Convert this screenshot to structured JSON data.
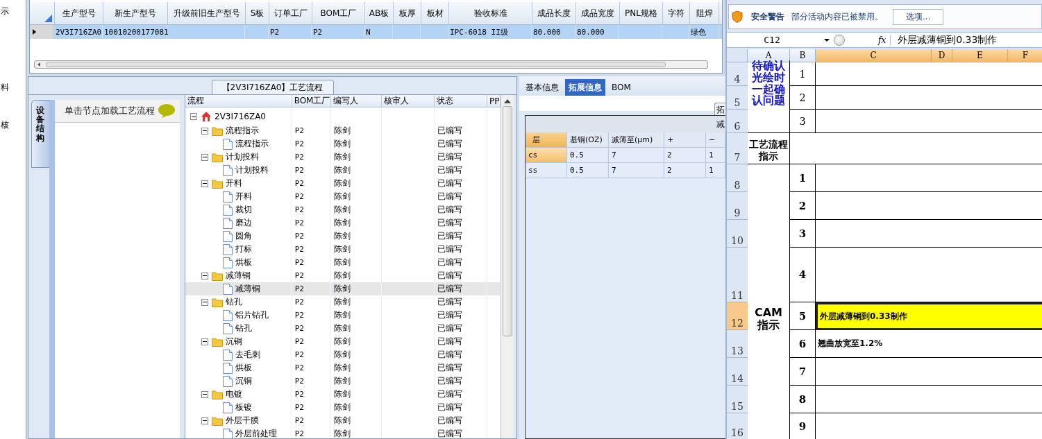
{
  "left_edge": [
    "示",
    "料",
    "核"
  ],
  "product_grid": {
    "columns": [
      "生产型号",
      "新生产型号",
      "升级前旧生产型号",
      "S板",
      "订单工厂",
      "BOM工厂",
      "AB板",
      "板厚",
      "板材",
      "验收标准",
      "成品长度",
      "成品宽度",
      "PNL规格",
      "字符",
      "阻焊"
    ],
    "rows": [
      {
        "selected": true,
        "cells": [
          "2V3I716ZA0",
          "10010200177081",
          "",
          "",
          "P2",
          "P2",
          "N",
          "",
          "",
          "IPC-6018 II级",
          "80.000",
          "80.000",
          "",
          "",
          "绿色"
        ]
      }
    ]
  },
  "process": {
    "title": "【2V3I716ZA0】工艺流程",
    "side_tab": "设备结构",
    "hint": "单击节点加载工艺流程",
    "columns": [
      "流程",
      "BOM工厂",
      "编写人",
      "核审人",
      "状态",
      "PP"
    ],
    "tree": [
      {
        "label": "2V3I716ZA0",
        "kind": "root",
        "selected": false,
        "expanded": true,
        "children": [
          {
            "label": "流程指示",
            "kind": "folder",
            "bom": "P2",
            "author": "陈剑",
            "status": "已编写",
            "selected": false,
            "expanded": true,
            "children": [
              {
                "label": "流程指示",
                "kind": "file",
                "bom": "P2",
                "author": "陈剑",
                "status": "已编写",
                "selected": false
              }
            ]
          },
          {
            "label": "计划投料",
            "kind": "folder",
            "bom": "P2",
            "author": "陈剑",
            "status": "已编写",
            "selected": false,
            "expanded": true,
            "children": [
              {
                "label": "计划投料",
                "kind": "file",
                "bom": "P2",
                "author": "陈剑",
                "status": "已编写",
                "selected": false
              }
            ]
          },
          {
            "label": "开料",
            "kind": "folder",
            "bom": "P2",
            "author": "陈剑",
            "status": "已编写",
            "selected": false,
            "expanded": true,
            "children": [
              {
                "label": "开料",
                "kind": "file",
                "bom": "P2",
                "author": "陈剑",
                "status": "已编写",
                "selected": false
              },
              {
                "label": "裁切",
                "kind": "file",
                "bom": "P2",
                "author": "陈剑",
                "status": "已编写",
                "selected": false
              },
              {
                "label": "磨边",
                "kind": "file",
                "bom": "P2",
                "author": "陈剑",
                "status": "已编写",
                "selected": false
              },
              {
                "label": "圆角",
                "kind": "file",
                "bom": "P2",
                "author": "陈剑",
                "status": "已编写",
                "selected": false
              },
              {
                "label": "打标",
                "kind": "file",
                "bom": "P2",
                "author": "陈剑",
                "status": "已编写",
                "selected": false
              },
              {
                "label": "烘板",
                "kind": "file",
                "bom": "P2",
                "author": "陈剑",
                "status": "已编写",
                "selected": false
              }
            ]
          },
          {
            "label": "减薄铜",
            "kind": "folder",
            "bom": "P2",
            "author": "陈剑",
            "status": "已编写",
            "selected": false,
            "expanded": true,
            "children": [
              {
                "label": "减薄铜",
                "kind": "file",
                "bom": "P2",
                "author": "陈剑",
                "status": "已编写",
                "selected": true
              }
            ]
          },
          {
            "label": "钻孔",
            "kind": "folder",
            "bom": "P2",
            "author": "陈剑",
            "status": "已编写",
            "selected": false,
            "expanded": true,
            "children": [
              {
                "label": "铝片钻孔",
                "kind": "file",
                "bom": "P2",
                "author": "陈剑",
                "status": "已编写",
                "selected": false
              },
              {
                "label": "钻孔",
                "kind": "file",
                "bom": "P2",
                "author": "陈剑",
                "status": "已编写",
                "selected": false
              }
            ]
          },
          {
            "label": "沉铜",
            "kind": "folder",
            "bom": "P2",
            "author": "陈剑",
            "status": "已编写",
            "selected": false,
            "expanded": true,
            "children": [
              {
                "label": "去毛刺",
                "kind": "file",
                "bom": "P2",
                "author": "陈剑",
                "status": "已编写",
                "selected": false
              },
              {
                "label": "烘板",
                "kind": "file",
                "bom": "P2",
                "author": "陈剑",
                "status": "已编写",
                "selected": false
              },
              {
                "label": "沉铜",
                "kind": "file",
                "bom": "P2",
                "author": "陈剑",
                "status": "已编写",
                "selected": false
              }
            ]
          },
          {
            "label": "电镀",
            "kind": "folder",
            "bom": "P2",
            "author": "陈剑",
            "status": "已编写",
            "selected": false,
            "expanded": true,
            "children": [
              {
                "label": "板镀",
                "kind": "file",
                "bom": "P2",
                "author": "陈剑",
                "status": "已编写",
                "selected": false
              }
            ]
          },
          {
            "label": "外层干膜",
            "kind": "folder",
            "bom": "P2",
            "author": "陈剑",
            "status": "已编写",
            "selected": false,
            "expanded": true,
            "children": [
              {
                "label": "外层前处理",
                "kind": "file",
                "bom": "P2",
                "author": "陈剑",
                "status": "已编写",
                "selected": false
              }
            ]
          }
        ]
      }
    ]
  },
  "info": {
    "tabs": [
      {
        "label": "基本信息",
        "selected": false
      },
      {
        "label": "拓展信息",
        "selected": true
      },
      {
        "label": "BOM",
        "selected": false
      }
    ],
    "toolbar_button": "拓",
    "band_text": "减",
    "columns": [
      "层",
      "基铜(OZ)",
      "减薄至(μm)",
      "+",
      "−"
    ],
    "rows": [
      {
        "selected": true,
        "cells": [
          "cs",
          "0.5",
          "7",
          "2",
          "1"
        ]
      },
      {
        "selected": false,
        "cells": [
          "ss",
          "0.5",
          "7",
          "2",
          "1"
        ]
      }
    ]
  },
  "excel": {
    "security": {
      "title": "安全警告",
      "message": "部分活动内容已被禁用。",
      "button": "选项..."
    },
    "name_box": "C12",
    "function_symbol": "fx",
    "formula": "外层减薄铜到0.33制作",
    "columns": [
      {
        "label": "A",
        "selected": false
      },
      {
        "label": "B",
        "selected": false
      },
      {
        "label": "C",
        "selected": true
      },
      {
        "label": "D",
        "selected": true
      },
      {
        "label": "E",
        "selected": true
      },
      {
        "label": "F",
        "selected": true
      }
    ],
    "rows": [
      {
        "label": "4",
        "selected": false
      },
      {
        "label": "5",
        "selected": false
      },
      {
        "label": "6",
        "selected": false
      },
      {
        "label": "7",
        "selected": false
      },
      {
        "label": "8",
        "selected": false
      },
      {
        "label": "9",
        "selected": false
      },
      {
        "label": "10",
        "selected": false
      },
      {
        "label": "11",
        "selected": false
      },
      {
        "label": "12",
        "selected": true
      },
      {
        "label": "13",
        "selected": false
      },
      {
        "label": "14",
        "selected": false
      },
      {
        "label": "15",
        "selected": false
      },
      {
        "label": "16",
        "selected": false
      }
    ],
    "sections": [
      {
        "kind": "pending",
        "title": "待确认光绘时一起确认问题",
        "items": [
          {
            "number": "1",
            "selected": false
          },
          {
            "number": "2",
            "selected": false
          },
          {
            "number": "3",
            "selected": false
          }
        ]
      },
      {
        "kind": "process",
        "title": "工艺流程指示"
      },
      {
        "kind": "cam",
        "title": "CAM 指示",
        "items": [
          {
            "number": "1",
            "selected": false
          },
          {
            "number": "2",
            "selected": false
          },
          {
            "number": "3",
            "selected": false
          },
          {
            "number": "4",
            "selected": false
          },
          {
            "number": "5",
            "selected": true,
            "text": "外层减薄铜到0.33制作",
            "color": "#ffff00"
          },
          {
            "number": "6",
            "selected": false,
            "text": "翘曲放宽至1.2%"
          },
          {
            "number": "7",
            "selected": false
          },
          {
            "number": "8",
            "selected": false
          },
          {
            "number": "9",
            "selected": false
          }
        ]
      }
    ]
  }
}
